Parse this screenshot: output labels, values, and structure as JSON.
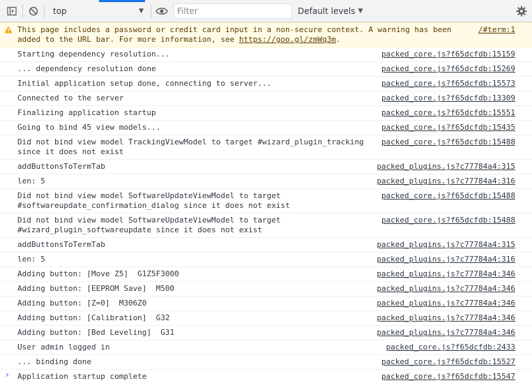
{
  "toolbar": {
    "context": "top",
    "filter_placeholder": "Filter",
    "levels_label": "Default levels"
  },
  "warning": {
    "line1": "This page includes a password or credit card input in a non-secure context. A warning has been",
    "line2_prefix": "added to the URL bar. For more information, see ",
    "link": "https://goo.gl/zmWq3m",
    "line2_suffix": ".",
    "source": "/#term:1"
  },
  "messages": [
    {
      "text": "Starting dependency resolution...",
      "source": "packed_core.js?f65dcfdb:15159"
    },
    {
      "text": "... dependency resolution done",
      "source": "packed_core.js?f65dcfdb:15269"
    },
    {
      "text": "Initial application setup done, connecting to server...",
      "source": "packed_core.js?f65dcfdb:15573"
    },
    {
      "text": "Connected to the server",
      "source": "packed_core.js?f65dcfdb:13309"
    },
    {
      "text": "Finalizing application startup",
      "source": "packed_core.js?f65dcfdb:15551"
    },
    {
      "text": "Going to bind 45 view models...",
      "source": "packed_core.js?f65dcfdb:15435"
    },
    {
      "text": "Did not bind view model TrackingViewModel to target #wizard_plugin_tracking\nsince it does not exist",
      "source": "packed_core.js?f65dcfdb:15488"
    },
    {
      "text": "addButtonsToTermTab",
      "source": "packed_plugins.js?c77784a4:315"
    },
    {
      "text": "len: 5",
      "source": "packed_plugins.js?c77784a4:316"
    },
    {
      "text": "Did not bind view model SoftwareUpdateViewModel to target\n#softwareupdate_confirmation_dialog since it does not exist",
      "source": "packed_core.js?f65dcfdb:15488"
    },
    {
      "text": "Did not bind view model SoftwareUpdateViewModel to target\n#wizard_plugin_softwareupdate since it does not exist",
      "source": "packed_core.js?f65dcfdb:15488"
    },
    {
      "text": "addButtonsToTermTab",
      "source": "packed_plugins.js?c77784a4:315"
    },
    {
      "text": "len: 5",
      "source": "packed_plugins.js?c77784a4:316"
    },
    {
      "text": "Adding button: [Move Z5]  G1Z5F3000",
      "source": "packed_plugins.js?c77784a4:346"
    },
    {
      "text": "Adding button: [EEPROM Save]  M500",
      "source": "packed_plugins.js?c77784a4:346"
    },
    {
      "text": "Adding button: [Z=0]  M306Z0",
      "source": "packed_plugins.js?c77784a4:346"
    },
    {
      "text": "Adding button: [Calibration]  G32",
      "source": "packed_plugins.js?c77784a4:346"
    },
    {
      "text": "Adding button: [Bed Leveling]  G31",
      "source": "packed_plugins.js?c77784a4:346"
    },
    {
      "text": "User admin logged in",
      "source": "packed_core.js?f65dcfdb:2433"
    },
    {
      "text": "... binding done",
      "source": "packed_core.js?f65dcfdb:15527"
    },
    {
      "text": "Application startup complete",
      "source": "packed_core.js?f65dcfdb:15547"
    }
  ],
  "prompt_glyph": "›",
  "colors": {
    "accent": "#1a73e8",
    "warning_bg": "#fffbe6",
    "warning_text": "#5c3c00",
    "warning_icon": "#f2a600"
  }
}
